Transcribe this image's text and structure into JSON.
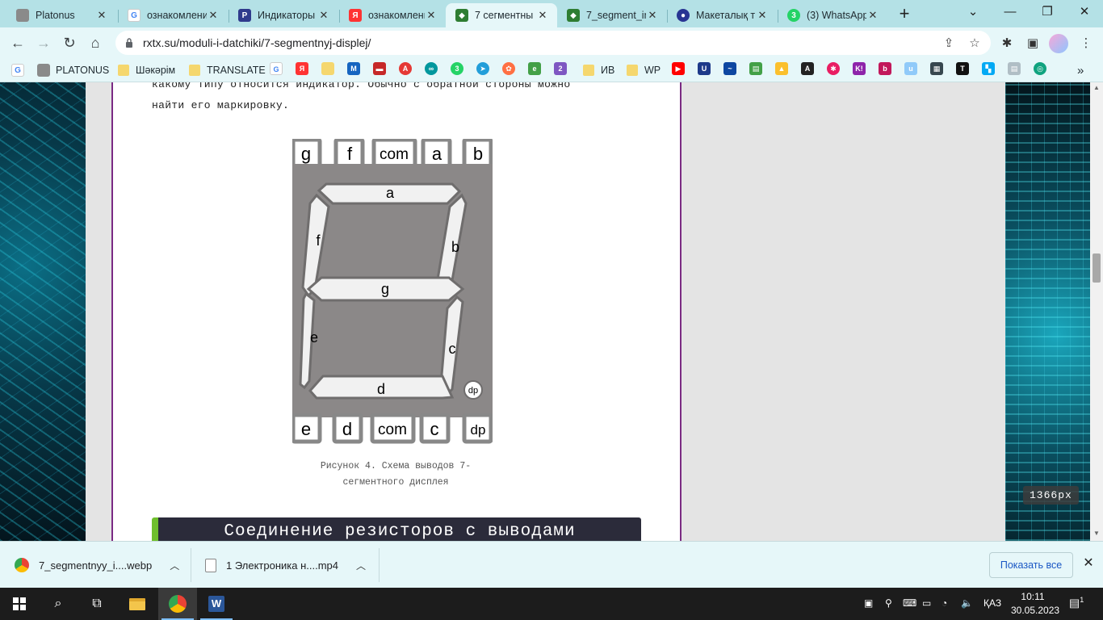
{
  "tabs": [
    {
      "title": "Platonus",
      "icon": "platonus-icon",
      "color": "#8a8a8a"
    },
    {
      "title": "ознакомлени",
      "icon": "google-icon",
      "color": "#4285f4"
    },
    {
      "title": "Индикаторы",
      "icon": "p-site-icon",
      "color": "#2f3a8c"
    },
    {
      "title": "ознакомлени",
      "icon": "yandex-icon",
      "color": "#ff3333"
    },
    {
      "title": "7 сегментны",
      "icon": "rxtx-icon",
      "color": "#2e7d32",
      "active": true
    },
    {
      "title": "7_segment_in",
      "icon": "rxtx-icon",
      "color": "#2e7d32"
    },
    {
      "title": "Макеталық т",
      "icon": "site-icon",
      "color": "#283593"
    },
    {
      "title": "(3) WhatsApp",
      "icon": "whatsapp-icon",
      "color": "#25d366"
    }
  ],
  "omnibox": {
    "url": "rxtx.su/moduli-i-datchiki/7-segmentnyj-displej/"
  },
  "bookmarks": [
    {
      "label": "",
      "icon": "google-icon"
    },
    {
      "label": "PLATONUS",
      "icon": "platonus-icon"
    },
    {
      "label": "Шәкәрім",
      "icon": "folder-icon"
    },
    {
      "label": "TRANSLATE",
      "icon": "folder-icon"
    },
    {
      "label": "ИВ",
      "icon": "folder-icon"
    },
    {
      "label": "WP",
      "icon": "folder-icon"
    }
  ],
  "article": {
    "para_top": "какому типу относится индикатор. Обычно с обратной стороны можно",
    "para_bottom": "найти его маркировку.",
    "caption_line1": "Рисунок 4. Схема выводов 7-",
    "caption_line2": "сегментного дисплея",
    "section_heading": "Соединение резисторов с выводами"
  },
  "figure": {
    "top_pins": [
      "g",
      "f",
      "com",
      "a",
      "b"
    ],
    "bottom_pins": [
      "e",
      "d",
      "com",
      "c",
      "dp"
    ],
    "segments": {
      "a": "a",
      "b": "b",
      "c": "c",
      "d": "d",
      "e": "e",
      "f": "f",
      "g": "g",
      "dp": "dp"
    }
  },
  "width_badge": "1366px",
  "downloads": [
    {
      "name": "7_segmentnyy_i....webp",
      "icon": "chrome-icon"
    },
    {
      "name": "1 Электроника н....mp4",
      "icon": "file-icon"
    }
  ],
  "download_bar": {
    "show_all": "Показать все"
  },
  "taskbar": {
    "lang": "ҚАЗ",
    "time": "10:11",
    "date": "30.05.2023",
    "notifications": "1"
  }
}
